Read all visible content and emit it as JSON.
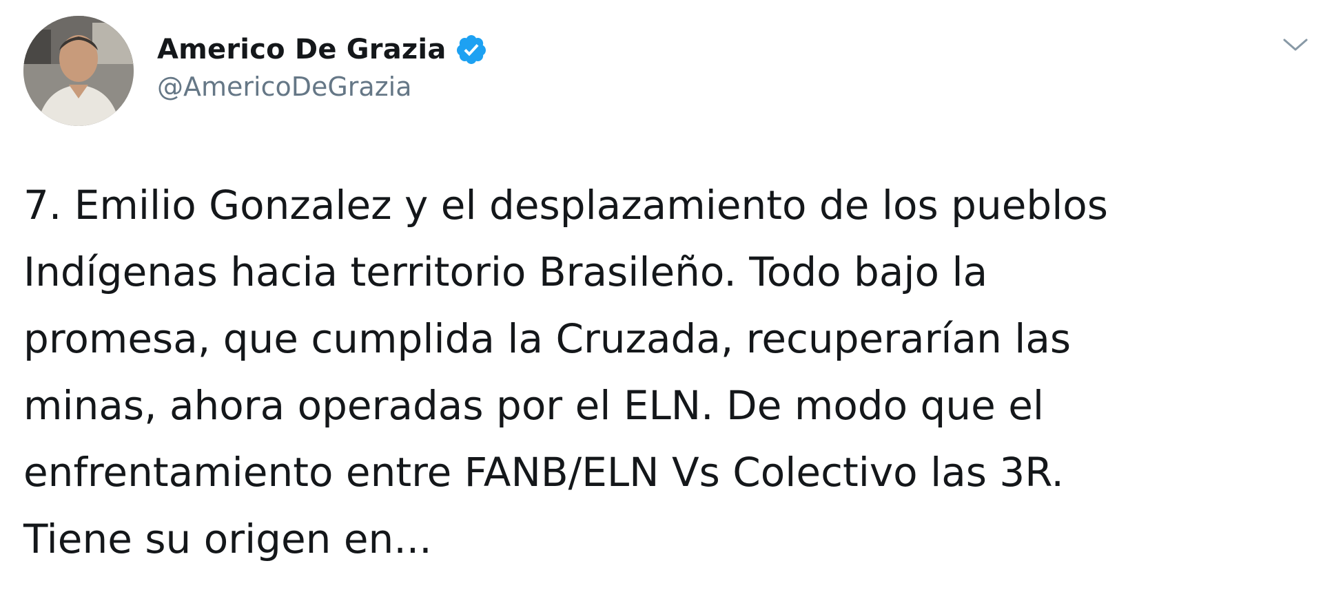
{
  "tweet": {
    "author": {
      "display_name": "Americo De Grazia",
      "handle": "@AmericoDeGrazia",
      "verified": true
    },
    "text_lines": [
      "7. Emilio Gonzalez y el desplazamiento de los pueblos",
      "Indígenas hacia territorio Brasileño. Todo bajo la",
      "promesa, que cumplida la Cruzada, recuperarían las",
      "minas, ahora operadas por el ELN. De modo que el",
      "enfrentamiento entre FANB/ELN Vs Colectivo las 3R.",
      "Tiene su origen en..."
    ]
  },
  "icons": {
    "verified": "verified-badge-icon",
    "menu": "chevron-down-icon"
  },
  "colors": {
    "text_primary": "#14171a",
    "text_secondary": "#657786",
    "verified_blue": "#1da1f2",
    "background": "#ffffff"
  }
}
